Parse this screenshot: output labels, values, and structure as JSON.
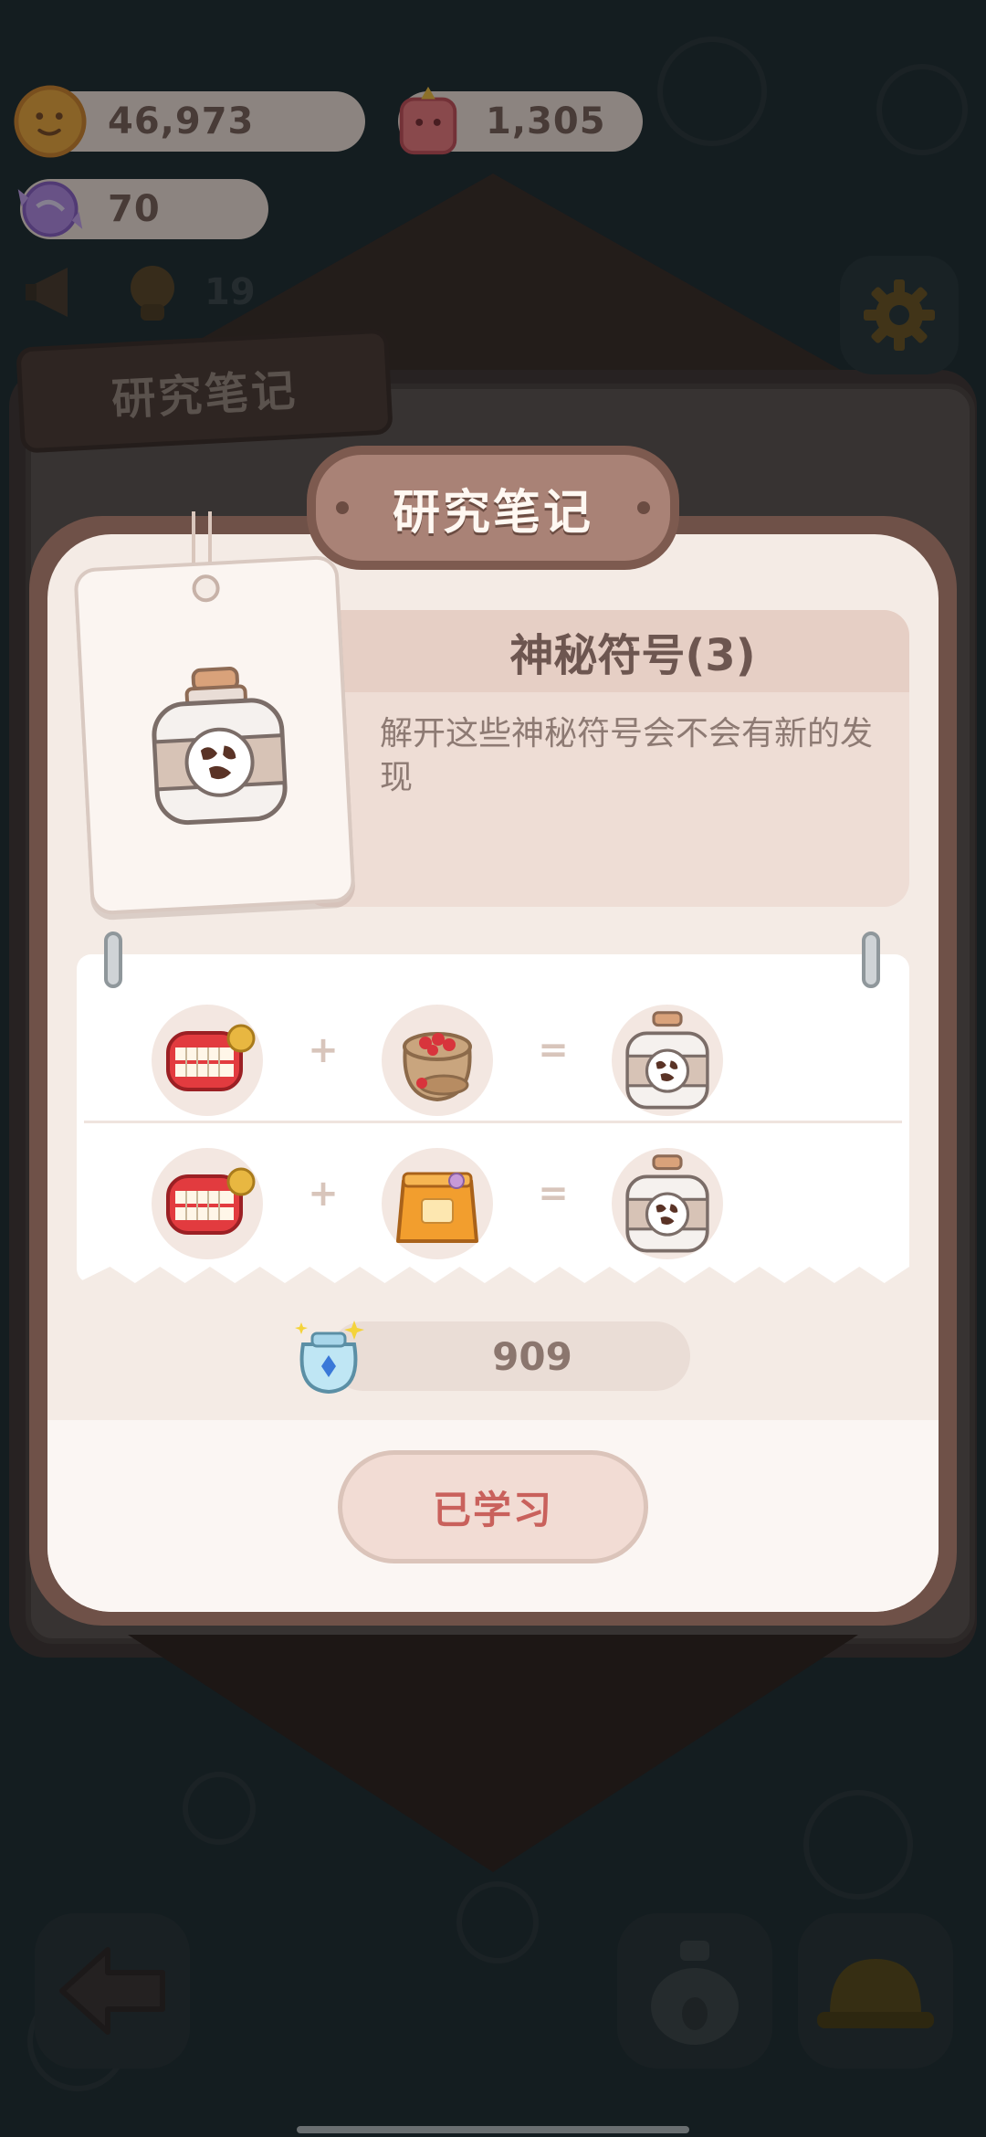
{
  "hud": {
    "cookies": "46,973",
    "jam": "1,305",
    "gems": "70",
    "dimmed_count": "19"
  },
  "book": {
    "tab_label": "研究笔记"
  },
  "modal": {
    "title": "研究笔记",
    "item_name": "神秘符号(3)",
    "item_description": "解开这些神秘符号会不会有新的发现",
    "recipes": [
      {
        "a_icon": "dentures-icon",
        "b_icon": "red-beans-sack-icon",
        "result_icon": "cow-jar-icon",
        "plus": "+",
        "equals": "="
      },
      {
        "a_icon": "dentures-icon",
        "b_icon": "orange-bag-icon",
        "result_icon": "cow-jar-icon",
        "plus": "+",
        "equals": "="
      }
    ],
    "cost_value": "909",
    "learned_button": "已学习"
  },
  "colors": {
    "accent_red": "#c9615c",
    "frame_brown": "#6f5148",
    "paper": "#f4ebe5"
  }
}
